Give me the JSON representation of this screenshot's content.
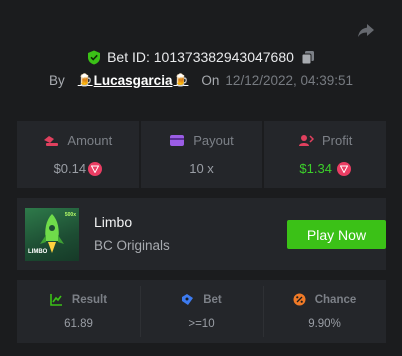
{
  "header": {
    "bet_id_label": "Bet ID: 101373382943047680",
    "by_label": "By",
    "username": "Lucasgarcia",
    "on_label": "On",
    "datetime": "12/12/2022, 04:39:51"
  },
  "stats": {
    "amount_label": "Amount",
    "amount_value": "$0.14",
    "payout_label": "Payout",
    "payout_value": "10 x",
    "profit_label": "Profit",
    "profit_value": "$1.34"
  },
  "game": {
    "name": "Limbo",
    "provider": "BC Originals",
    "thumb_title": "LIMBO",
    "thumb_mult": "500x",
    "play_label": "Play Now"
  },
  "results": {
    "result_label": "Result",
    "result_value": "61.89",
    "bet_label": "Bet",
    "bet_value": ">=10",
    "chance_label": "Chance",
    "chance_value": "9.90%"
  },
  "colors": {
    "background": "#1b1c1e",
    "panel": "#24262a",
    "accent_green": "#3bc117",
    "profit_green": "#3ccf2a",
    "coin_red": "#ea3d63"
  },
  "icons": [
    "share-icon",
    "shield-check-icon",
    "copy-icon",
    "amount-icon",
    "payout-icon",
    "profit-icon",
    "coin-icon",
    "result-icon",
    "bet-icon",
    "chance-icon"
  ]
}
